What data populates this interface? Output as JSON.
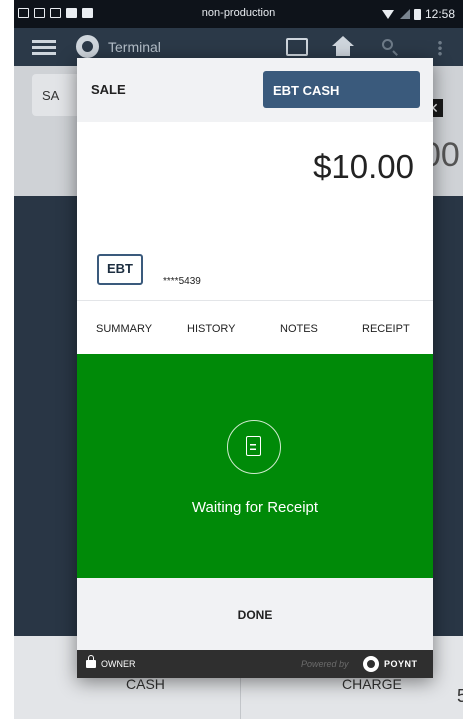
{
  "status_bar": {
    "carrier": "non-production",
    "time": "12:58"
  },
  "app_bar": {
    "title": "Terminal"
  },
  "background": {
    "tab_label": "SA",
    "close_label": "✕",
    "amount_partial": "00",
    "cash_label": "CASH",
    "charge_label": "CHARGE",
    "corner_digit": "5"
  },
  "modal": {
    "header": {
      "sale_label": "SALE",
      "payment_type": "EBT CASH"
    },
    "amount": "$10.00",
    "card": {
      "brand_label": "EBT",
      "masked_number": "****5439"
    },
    "tabs": [
      {
        "label": "SUMMARY"
      },
      {
        "label": "HISTORY"
      },
      {
        "label": "NOTES"
      },
      {
        "label": "RECEIPT"
      }
    ],
    "status_message": "Waiting for Receipt",
    "done_label": "DONE",
    "footer": {
      "owner_label": "OWNER",
      "powered_by": "Powered by",
      "brand": "POYNT"
    }
  },
  "colors": {
    "status_green": "#008a08",
    "ebt_tag": "#3a5a7c",
    "footer_dark": "#2f2f2f",
    "app_bar": "#2b3948"
  },
  "icons": [
    "hamburger-icon",
    "poynt-logo-icon",
    "register-icon",
    "home-icon",
    "search-icon",
    "more-icon",
    "receipt-icon",
    "lock-icon",
    "poynt-mark-icon"
  ]
}
